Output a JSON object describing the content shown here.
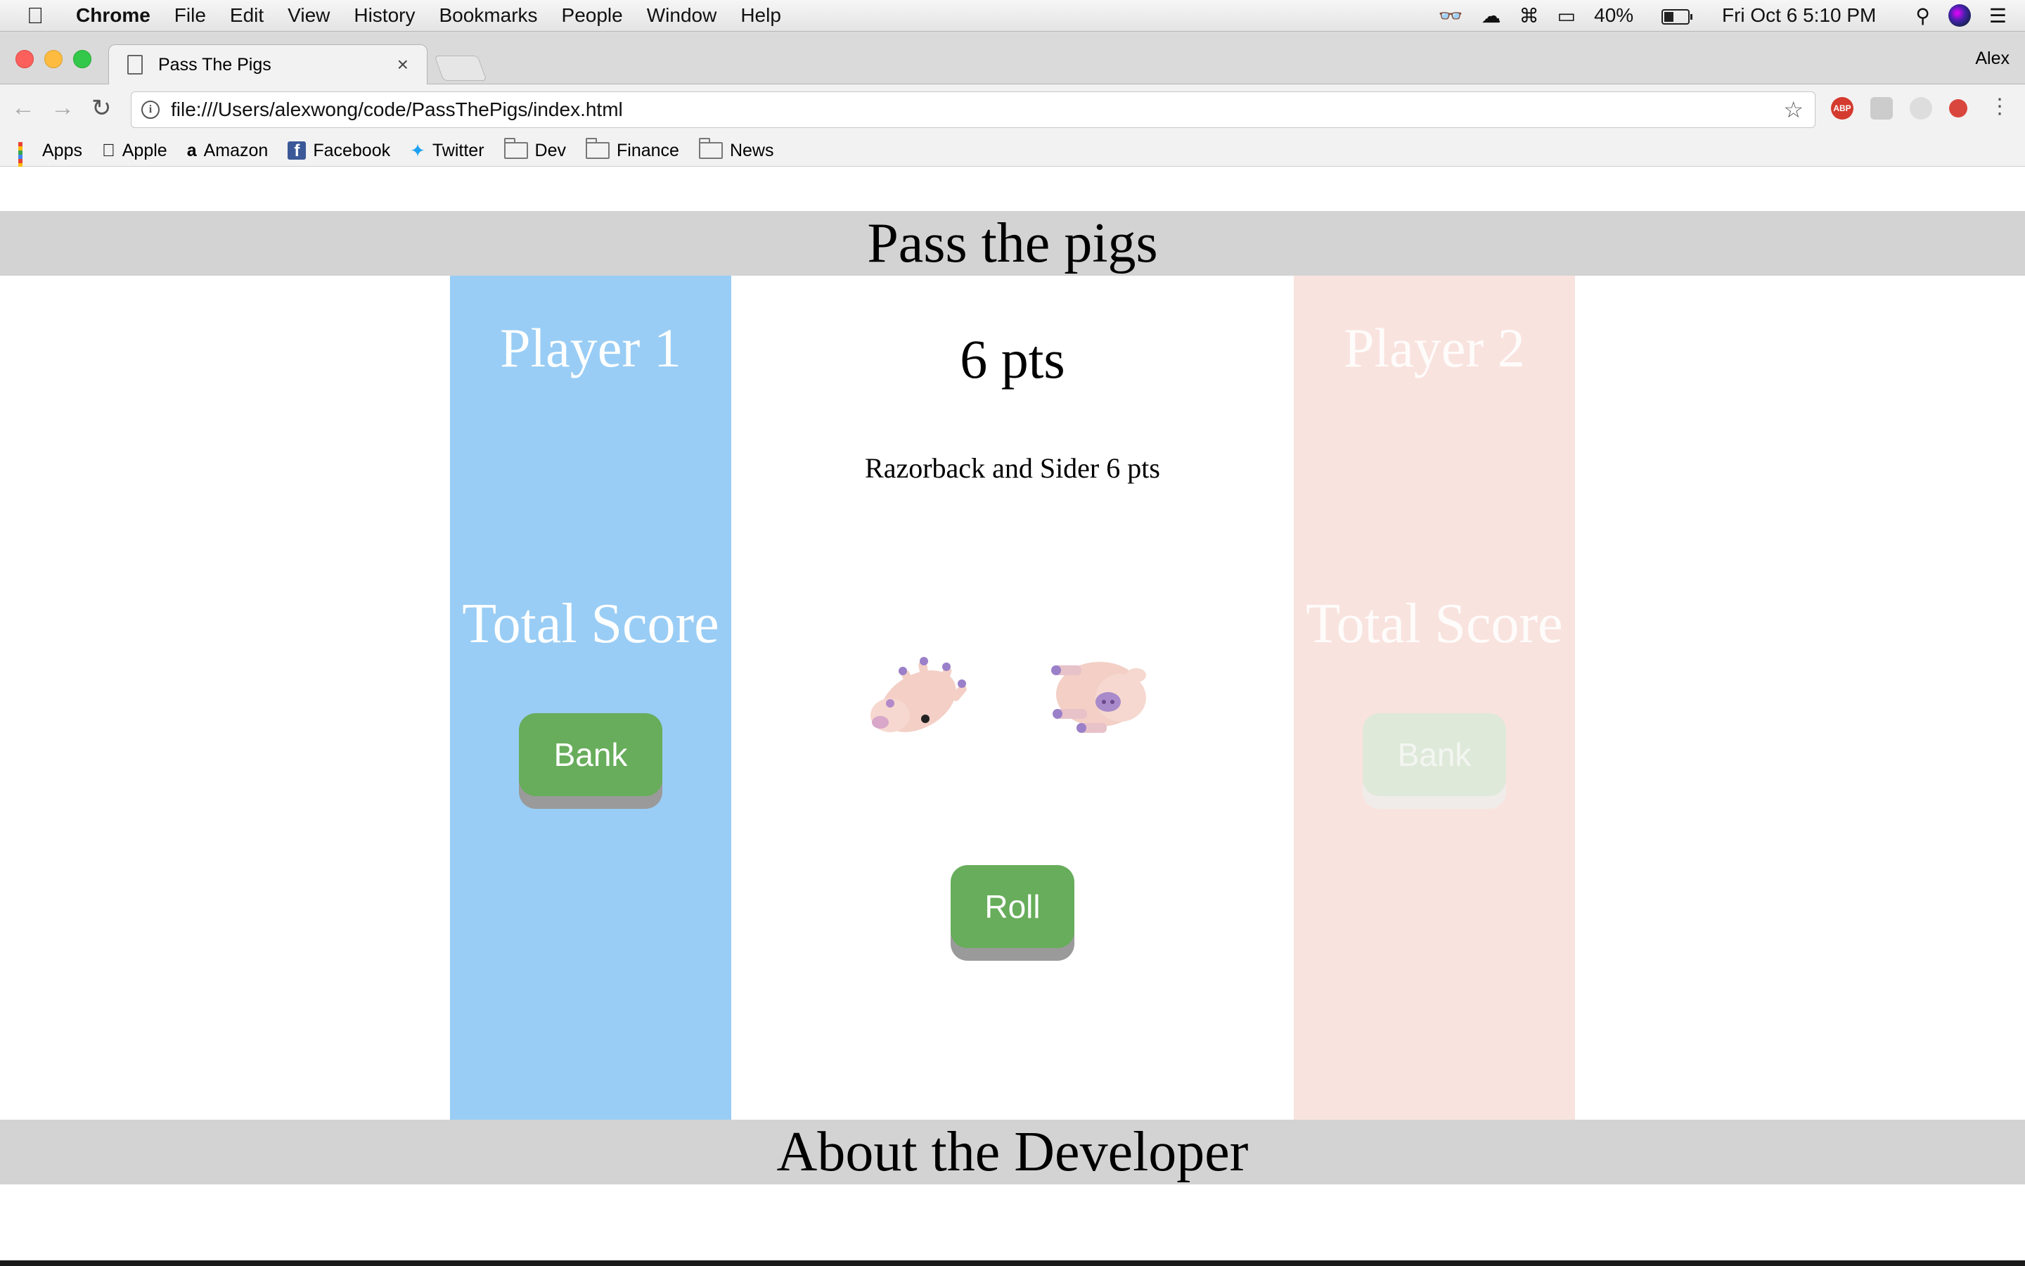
{
  "menubar": {
    "app_name": "Chrome",
    "items": [
      "File",
      "Edit",
      "View",
      "History",
      "Bookmarks",
      "People",
      "Window",
      "Help"
    ],
    "battery": "40%",
    "datetime": "Fri Oct 6  5:10 PM"
  },
  "browser": {
    "tab_title": "Pass The Pigs",
    "profile_name": "Alex",
    "url": "file:///Users/alexwong/code/PassThePigs/index.html",
    "bookmarks": [
      "Apps",
      "Apple",
      "Amazon",
      "Facebook",
      "Twitter",
      "Dev",
      "Finance",
      "News"
    ]
  },
  "page": {
    "title": "Pass the pigs",
    "player1": {
      "name": "Player 1",
      "total_label": "Total Score",
      "bank_label": "Bank"
    },
    "player2": {
      "name": "Player 2",
      "total_label": "Total Score",
      "bank_label": "Bank"
    },
    "turn_points": "6 pts",
    "roll_description": "Razorback and Sider 6 pts",
    "roll_label": "Roll",
    "footer_title": "About the Developer"
  },
  "colors": {
    "player1_panel": "#99cdf5",
    "player2_panel": "#f9e3df",
    "button_green": "#67ad5b",
    "header_bar": "#d3d3d3"
  }
}
